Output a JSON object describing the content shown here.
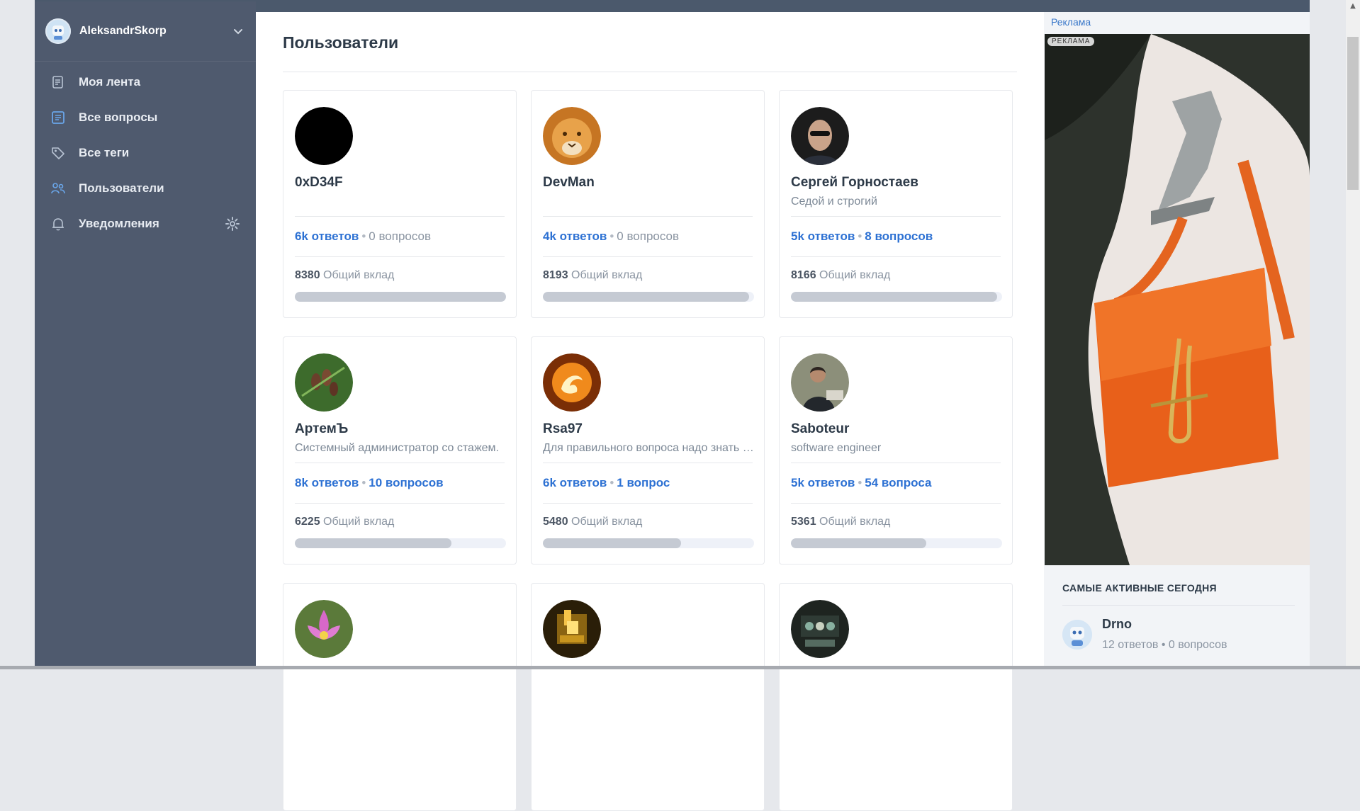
{
  "sidebar": {
    "user": {
      "name": "AleksandrSkorp"
    },
    "items": [
      {
        "label": "Моя лента",
        "icon": "feed-icon"
      },
      {
        "label": "Все вопросы",
        "icon": "questions-icon"
      },
      {
        "label": "Все теги",
        "icon": "tag-icon"
      },
      {
        "label": "Пользователи",
        "icon": "users-icon"
      },
      {
        "label": "Уведомления",
        "icon": "bell-icon"
      }
    ]
  },
  "main": {
    "title": "Пользователи",
    "users": [
      {
        "name": "0xD34F",
        "bio": "",
        "answers": "6k ответов",
        "questions": "0 вопросов",
        "questions_link": false,
        "contribution": "8380",
        "contribution_label": "Общий вклад",
        "progress": 1.0
      },
      {
        "name": "DevMan",
        "bio": "",
        "answers": "4k ответов",
        "questions": "0 вопросов",
        "questions_link": false,
        "contribution": "8193",
        "contribution_label": "Общий вклад",
        "progress": 0.978
      },
      {
        "name": "Сергей Горностаев",
        "bio": "Седой и строгий",
        "answers": "5k ответов",
        "questions": "8 вопросов",
        "questions_link": true,
        "contribution": "8166",
        "contribution_label": "Общий вклад",
        "progress": 0.975
      },
      {
        "name": "АртемЪ",
        "bio": "Системный администратор со стажем.",
        "answers": "8k ответов",
        "questions": "10 вопросов",
        "questions_link": true,
        "contribution": "6225",
        "contribution_label": "Общий вклад",
        "progress": 0.743
      },
      {
        "name": "Rsa97",
        "bio": "Для правильного вопроса надо знать половину ответа",
        "answers": "6k ответов",
        "questions": "1 вопрос",
        "questions_link": true,
        "contribution": "5480",
        "contribution_label": "Общий вклад",
        "progress": 0.654
      },
      {
        "name": "Saboteur",
        "bio": "software engineer",
        "answers": "5k ответов",
        "questions": "54 вопроса",
        "questions_link": true,
        "contribution": "5361",
        "contribution_label": "Общий вклад",
        "progress": 0.64
      },
      {
        "name": "",
        "bio": "",
        "answers": "",
        "questions": "",
        "questions_link": false,
        "contribution": "",
        "contribution_label": "",
        "progress": 0
      },
      {
        "name": "",
        "bio": "",
        "answers": "",
        "questions": "",
        "questions_link": false,
        "contribution": "",
        "contribution_label": "",
        "progress": 0
      },
      {
        "name": "",
        "bio": "",
        "answers": "",
        "questions": "",
        "questions_link": false,
        "contribution": "",
        "contribution_label": "",
        "progress": 0
      }
    ]
  },
  "aside": {
    "ad_label": "Реклама",
    "ad_badge": "РЕКЛАМА",
    "active_title": "САМЫЕ АКТИВНЫЕ СЕГОДНЯ",
    "active_users": [
      {
        "name": "Drno",
        "answers": "12 ответов",
        "questions": "0 вопросов"
      }
    ]
  },
  "colors": {
    "sidebar": "#4f5a6e",
    "link": "#2d71d3",
    "muted": "#8a94a1"
  }
}
